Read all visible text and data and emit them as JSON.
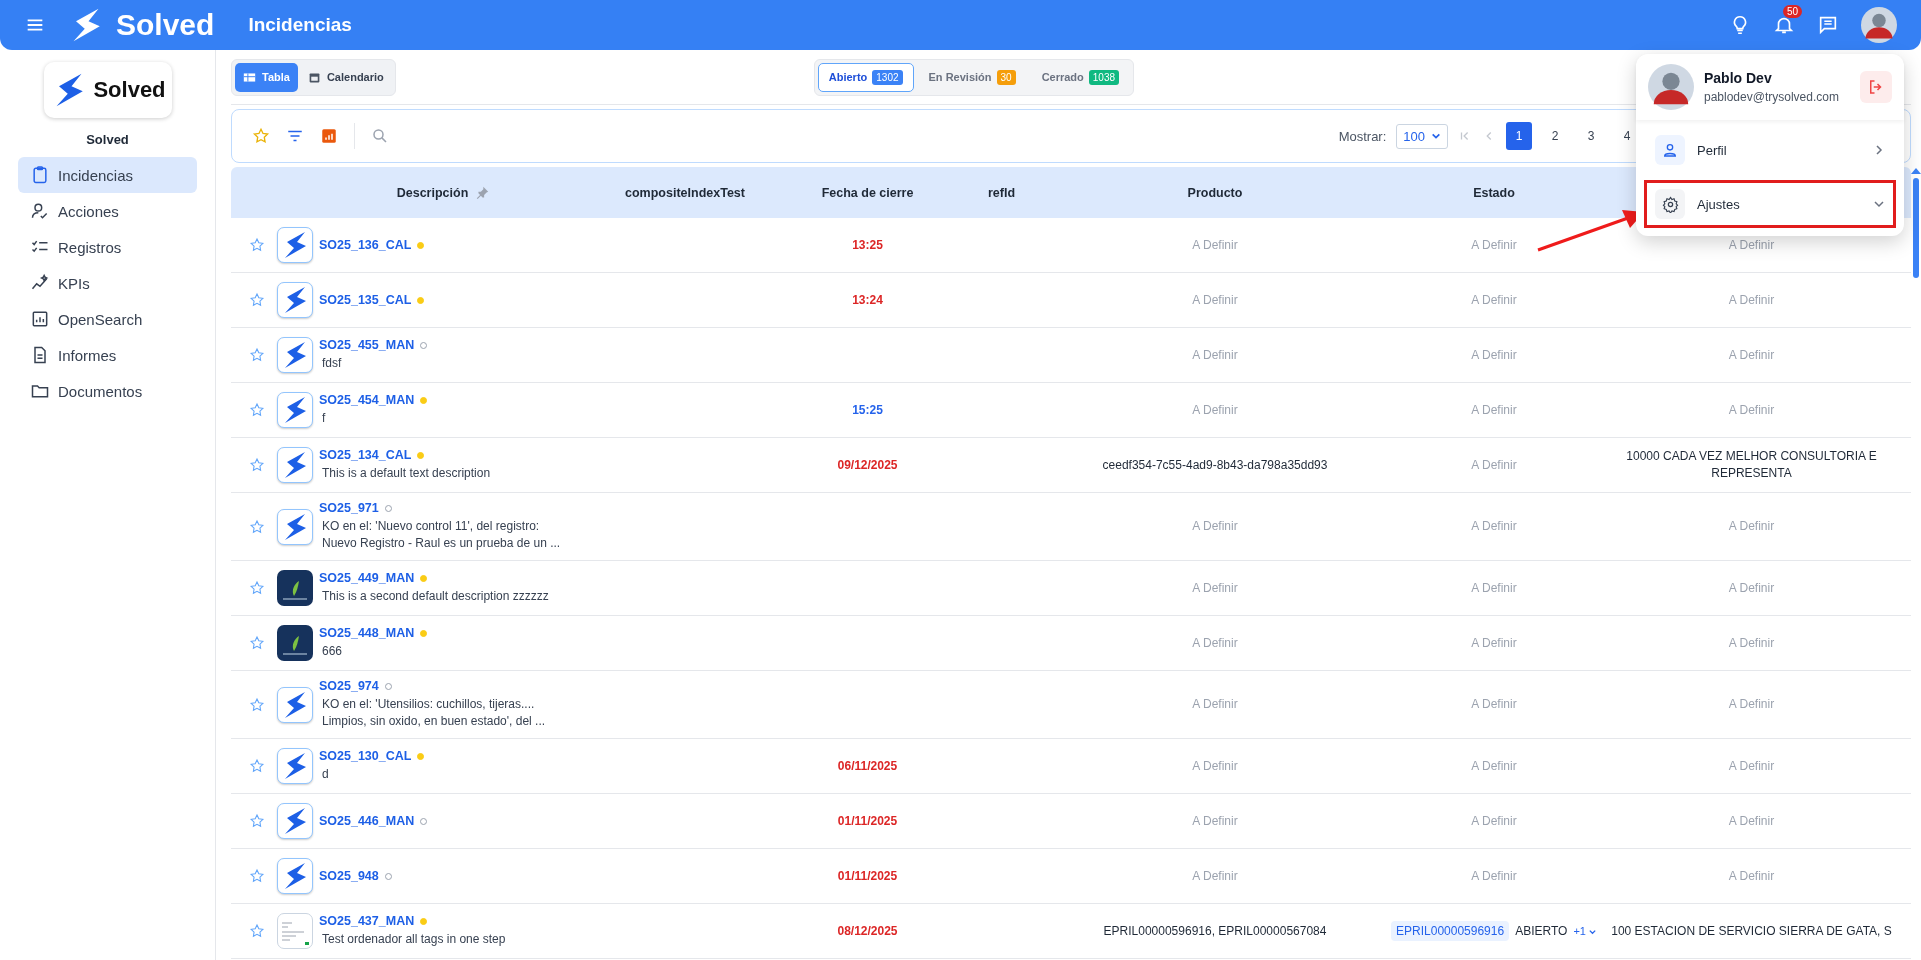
{
  "topbar": {
    "brand": "Solved",
    "title": "Incidencias",
    "notifications": "50"
  },
  "sidebar": {
    "logo_text": "Solved",
    "brand": "Solved",
    "items": [
      {
        "label": "Incidencias",
        "selected": true
      },
      {
        "label": "Acciones",
        "selected": false
      },
      {
        "label": "Registros",
        "selected": false
      },
      {
        "label": "KPIs",
        "selected": false
      },
      {
        "label": "OpenSearch",
        "selected": false
      },
      {
        "label": "Informes",
        "selected": false
      },
      {
        "label": "Documentos",
        "selected": false
      }
    ]
  },
  "view_toggle": [
    {
      "label": "Tabla",
      "selected": true
    },
    {
      "label": "Calendario",
      "selected": false
    }
  ],
  "status_tabs": [
    {
      "label": "Abierto",
      "count": "1302",
      "color": "#3b82f6",
      "selected": true
    },
    {
      "label": "En Revisión",
      "count": "30",
      "color": "#f59e0b",
      "selected": false
    },
    {
      "label": "Cerrado",
      "count": "1038",
      "color": "#10b981",
      "selected": false
    }
  ],
  "pagination": {
    "label": "Mostrar:",
    "page_size": "100",
    "pages": [
      {
        "label": "1",
        "selected": true
      },
      {
        "label": "2",
        "selected": false
      },
      {
        "label": "3",
        "selected": false
      },
      {
        "label": "4",
        "selected": false
      }
    ]
  },
  "table": {
    "columns": [
      {
        "label": "Descripción",
        "pinned": true
      },
      {
        "label": "compositeIndexTest",
        "pinned": false
      },
      {
        "label": "Fecha de cierre",
        "pinned": false
      },
      {
        "label": "refId",
        "pinned": false
      },
      {
        "label": "Producto",
        "pinned": false
      },
      {
        "label": "Estado",
        "pinned": false
      }
    ],
    "rows": [
      {
        "starred": false,
        "kind": "logo",
        "code": "SO25_136_CAL",
        "dot_filled": true,
        "close_date": {
          "text": "13:25",
          "overdue": true
        },
        "producto": {
          "text": "A Definir",
          "muted": true
        },
        "estado": {
          "text": "A Definir",
          "muted": true
        },
        "column_7": {
          "text": "A Definir",
          "muted": true
        }
      },
      {
        "starred": false,
        "kind": "logo",
        "code": "SO25_135_CAL",
        "dot_filled": true,
        "close_date": {
          "text": "13:24",
          "overdue": true
        },
        "producto": {
          "text": "A Definir",
          "muted": true
        },
        "estado": {
          "text": "A Definir",
          "muted": true
        },
        "column_7": {
          "text": "A Definir",
          "muted": true
        }
      },
      {
        "starred": false,
        "kind": "logo",
        "code": "SO25_455_MAN",
        "dot_filled": false,
        "description": "fdsf",
        "producto": {
          "text": "A Definir",
          "muted": true
        },
        "estado": {
          "text": "A Definir",
          "muted": true
        },
        "column_7": {
          "text": "A Definir",
          "muted": true
        }
      },
      {
        "starred": false,
        "kind": "logo",
        "code": "SO25_454_MAN",
        "dot_filled": true,
        "description": "f",
        "close_date": {
          "text": "15:25",
          "overdue": false
        },
        "producto": {
          "text": "A Definir",
          "muted": true
        },
        "estado": {
          "text": "A Definir",
          "muted": true
        },
        "column_7": {
          "text": "A Definir",
          "muted": true
        }
      },
      {
        "starred": false,
        "kind": "logo",
        "code": "SO25_134_CAL",
        "dot_filled": true,
        "description": "This is a default text description",
        "close_date": {
          "text": "09/12/2025",
          "overdue": true
        },
        "producto": {
          "text": "ceedf354-7c55-4ad9-8b43-da798a35dd93",
          "muted": false
        },
        "estado": {
          "text": "A Definir",
          "muted": true
        },
        "column_7": {
          "text": "10000 CADA VEZ MELHOR CONSULTORIA E REPRESENTA",
          "muted": false
        }
      },
      {
        "starred": false,
        "kind": "logo",
        "code": "SO25_971",
        "dot_filled": false,
        "description": "KO en el: 'Nuevo control 11', del registro: Nuevo Registro - Raul  es un prueba de un ...",
        "producto": {
          "text": "A Definir",
          "muted": true
        },
        "estado": {
          "text": "A Definir",
          "muted": true
        },
        "column_7": {
          "text": "A Definir",
          "muted": true
        }
      },
      {
        "starred": false,
        "kind": "leaf",
        "code": "SO25_449_MAN",
        "dot_filled": true,
        "description": "This is a second default description zzzzzz",
        "producto": {
          "text": "A Definir",
          "muted": true
        },
        "estado": {
          "text": "A Definir",
          "muted": true
        },
        "column_7": {
          "text": "A Definir",
          "muted": true
        }
      },
      {
        "starred": false,
        "kind": "leaf",
        "code": "SO25_448_MAN",
        "dot_filled": true,
        "description": "666",
        "producto": {
          "text": "A Definir",
          "muted": true
        },
        "estado": {
          "text": "A Definir",
          "muted": true
        },
        "column_7": {
          "text": "A Definir",
          "muted": true
        }
      },
      {
        "starred": false,
        "kind": "logo",
        "code": "SO25_974",
        "dot_filled": false,
        "description": "KO en el: 'Utensilios: cuchillos, tijeras.... Limpios, sin oxido, en buen estado', del ...",
        "producto": {
          "text": "A Definir",
          "muted": true
        },
        "estado": {
          "text": "A Definir",
          "muted": true
        },
        "column_7": {
          "text": "A Definir",
          "muted": true
        }
      },
      {
        "starred": false,
        "kind": "logo",
        "code": "SO25_130_CAL",
        "dot_filled": true,
        "description": "d",
        "close_date": {
          "text": "06/11/2025",
          "overdue": true
        },
        "producto": {
          "text": "A Definir",
          "muted": true
        },
        "estado": {
          "text": "A Definir",
          "muted": true
        },
        "column_7": {
          "text": "A Definir",
          "muted": true
        }
      },
      {
        "starred": false,
        "kind": "logo",
        "code": "SO25_446_MAN",
        "dot_filled": false,
        "close_date": {
          "text": "01/11/2025",
          "overdue": true
        },
        "producto": {
          "text": "A Definir",
          "muted": true
        },
        "estado": {
          "text": "A Definir",
          "muted": true
        },
        "column_7": {
          "text": "A Definir",
          "muted": true
        }
      },
      {
        "starred": false,
        "kind": "logo",
        "code": "SO25_948",
        "dot_filled": false,
        "close_date": {
          "text": "01/11/2025",
          "overdue": true
        },
        "producto": {
          "text": "A Definir",
          "muted": true
        },
        "estado": {
          "text": "A Definir",
          "muted": true
        },
        "column_7": {
          "text": "A Definir",
          "muted": true
        }
      },
      {
        "starred": false,
        "kind": "document",
        "code": "SO25_437_MAN",
        "dot_filled": true,
        "description": "Test ordenador all tags in one step",
        "close_date": {
          "text": "08/12/2025",
          "overdue": true
        },
        "producto": {
          "text": "EPRIL00000596916, EPRIL00000567084",
          "muted": false
        },
        "estado": {
          "tag": "EPRIL00000596916",
          "text": "ABIERTO",
          "more": "+1",
          "muted": false
        },
        "column_7": {
          "text": "100 ESTACION DE SERVICIO SIERRA DE GATA, S",
          "muted": false
        }
      }
    ]
  },
  "user_menu": {
    "name": "Pablo Dev",
    "email": "pablodev@trysolved.com",
    "items": [
      {
        "label": "Perfil",
        "expandable": false,
        "highlighted": false
      },
      {
        "label": "Ajustes",
        "expandable": true,
        "highlighted": true
      }
    ]
  }
}
